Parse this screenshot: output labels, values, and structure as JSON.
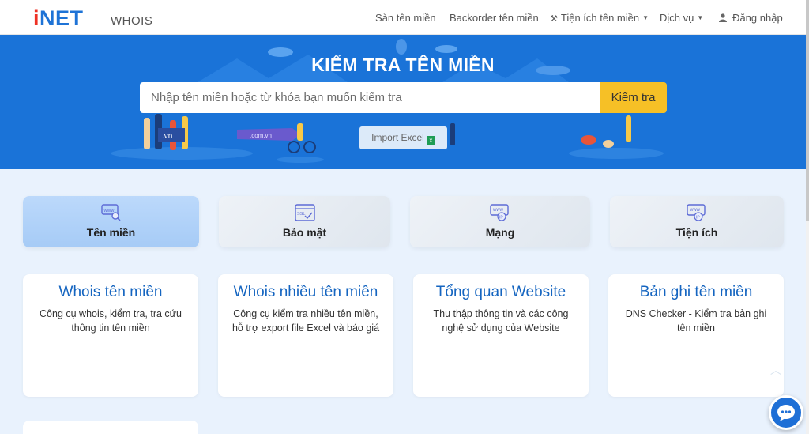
{
  "brand": {
    "logo_i": "i",
    "logo_net": "NET",
    "subtitle": "WHOIS"
  },
  "nav": {
    "items": [
      {
        "label": "Sàn tên miền"
      },
      {
        "label": "Backorder tên miền"
      },
      {
        "label": "Tiện ích tên miền",
        "has_dropdown": true,
        "icon": "tools-icon"
      },
      {
        "label": "Dịch vụ",
        "has_dropdown": true
      },
      {
        "label": "Đăng nhập",
        "icon": "user-icon"
      }
    ]
  },
  "hero": {
    "title": "KIỂM TRA TÊN MIỀN",
    "search_placeholder": "Nhập tên miền hoặc từ khóa bạn muốn kiểm tra",
    "search_value": "",
    "search_button": "Kiểm tra",
    "import_button": "Import Excel",
    "illustration_labels": {
      "vn": ".vn",
      "comvn": ".com.vn"
    }
  },
  "tabs": [
    {
      "label": "Tên miền",
      "icon": "www-search-icon",
      "active": true
    },
    {
      "label": "Bảo mật",
      "icon": "ssl-icon",
      "active": false
    },
    {
      "label": "Mạng",
      "icon": "www-ip-icon",
      "active": false
    },
    {
      "label": "Tiện ích",
      "icon": "www-ip-icon",
      "active": false
    }
  ],
  "cards": [
    {
      "title": "Whois tên miền",
      "desc": "Công cụ whois, kiểm tra, tra cứu thông tin tên miền"
    },
    {
      "title": "Whois nhiều tên miền",
      "desc": "Công cụ kiểm tra nhiều tên miền, hỗ trợ export file Excel và báo giá"
    },
    {
      "title": "Tổng quan Website",
      "desc": "Thu thập thông tin và các công nghệ sử dụng của Website"
    },
    {
      "title": "Bản ghi tên miền",
      "desc": "DNS Checker - Kiểm tra bản ghi tên miền"
    }
  ],
  "colors": {
    "hero_bg": "#1a73d8",
    "accent_yellow": "#f6c026",
    "brand_red": "#ee3124",
    "brand_blue": "#1e73d6",
    "card_title": "#1565c0"
  }
}
